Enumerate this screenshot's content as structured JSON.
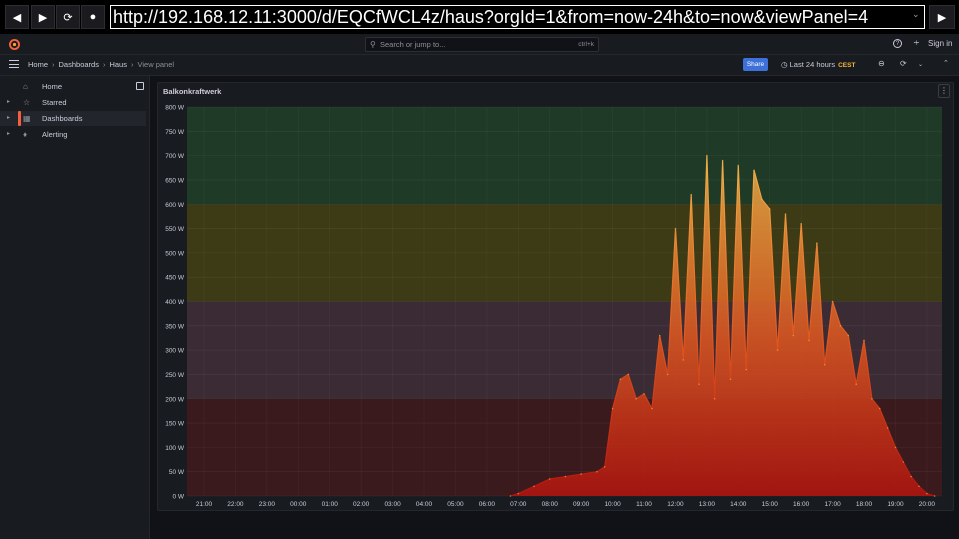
{
  "browser": {
    "url": "http://192.168.12.11:3000/d/EQCfWCL4z/haus?orgId=1&from=now-24h&to=now&viewPanel=4",
    "icons": [
      "back-arrow-icon",
      "forward-arrow-icon",
      "reload-icon",
      "stop-icon",
      "go-icon"
    ]
  },
  "topbar": {
    "search_placeholder": "Search or jump to...",
    "search_shortcut": "ctrl+k",
    "signin_label": "Sign in"
  },
  "breadcrumb": {
    "items": [
      "Home",
      "Dashboards",
      "Haus",
      "View panel"
    ]
  },
  "toolbar": {
    "share_label": "Share",
    "time_range": "Last 24 hours",
    "timezone": "CEST"
  },
  "sidebar": {
    "items": [
      {
        "label": "Home",
        "icon": "home-icon"
      },
      {
        "label": "Starred",
        "icon": "star-icon"
      },
      {
        "label": "Dashboards",
        "icon": "grid-icon",
        "active": true
      },
      {
        "label": "Alerting",
        "icon": "bell-icon"
      }
    ]
  },
  "panel": {
    "title": "Balkonkraftwerk"
  },
  "colors": {
    "band_green": "#1f3a26",
    "band_yellow": "#3d3a16",
    "band_purple": "#3a2b35",
    "band_red": "#3a1a1c",
    "line_top": "#f2b84b",
    "line_bottom": "#b3140f",
    "grafana_orange": "#f55f3e"
  },
  "chart_data": {
    "type": "area",
    "title": "Balkonkraftwerk",
    "y_unit": "W",
    "ylim": [
      0,
      800
    ],
    "y_ticks": [
      "0 W",
      "50 W",
      "100 W",
      "150 W",
      "200 W",
      "250 W",
      "300 W",
      "350 W",
      "400 W",
      "450 W",
      "500 W",
      "550 W",
      "600 W",
      "650 W",
      "700 W",
      "750 W",
      "800 W"
    ],
    "x_ticks": [
      "21:00",
      "22:00",
      "23:00",
      "00:00",
      "01:00",
      "02:00",
      "03:00",
      "04:00",
      "05:00",
      "06:00",
      "07:00",
      "08:00",
      "09:00",
      "10:00",
      "11:00",
      "12:00",
      "13:00",
      "14:00",
      "15:00",
      "16:00",
      "17:00",
      "18:00",
      "19:00",
      "20:00"
    ],
    "threshold_bands": [
      {
        "from": 0,
        "to": 200,
        "color": "red"
      },
      {
        "from": 200,
        "to": 400,
        "color": "purple"
      },
      {
        "from": 400,
        "to": 600,
        "color": "yellow"
      },
      {
        "from": 600,
        "to": 800,
        "color": "green"
      }
    ],
    "grid": true,
    "series": [
      {
        "x": [
          "06:45",
          "07:00",
          "07:30",
          "08:00",
          "08:30",
          "09:00",
          "09:30",
          "09:45",
          "10:00",
          "10:15",
          "10:30",
          "10:45",
          "11:00",
          "11:15",
          "11:30",
          "11:45",
          "12:00",
          "12:15",
          "12:30",
          "12:45",
          "13:00",
          "13:15",
          "13:30",
          "13:45",
          "14:00",
          "14:15",
          "14:30",
          "14:45",
          "15:00",
          "15:15",
          "15:30",
          "15:45",
          "16:00",
          "16:15",
          "16:30",
          "16:45",
          "17:00",
          "17:15",
          "17:30",
          "17:45",
          "18:00",
          "18:15",
          "18:30",
          "18:45",
          "19:00",
          "19:15",
          "19:30",
          "19:45",
          "20:00",
          "20:15"
        ],
        "y": [
          0,
          5,
          20,
          35,
          40,
          45,
          50,
          60,
          180,
          240,
          250,
          200,
          210,
          180,
          330,
          250,
          550,
          280,
          620,
          230,
          700,
          200,
          690,
          240,
          680,
          260,
          670,
          610,
          590,
          300,
          580,
          330,
          560,
          320,
          520,
          270,
          400,
          350,
          330,
          230,
          320,
          200,
          180,
          140,
          100,
          70,
          40,
          20,
          5,
          0
        ]
      }
    ]
  }
}
